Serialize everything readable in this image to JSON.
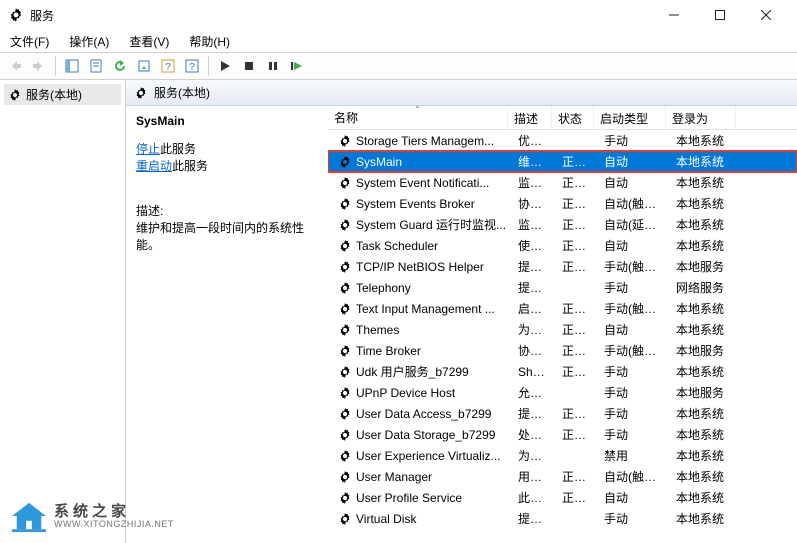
{
  "window": {
    "title": "服务"
  },
  "menu": {
    "file": "文件(F)",
    "action": "操作(A)",
    "view": "查看(V)",
    "help": "帮助(H)"
  },
  "tree": {
    "root": "服务(本地)"
  },
  "contentHeader": {
    "label": "服务(本地)"
  },
  "detail": {
    "selectedName": "SysMain",
    "stopLink": "停止",
    "stopSuffix": "此服务",
    "restartLink": "重启动",
    "restartSuffix": "此服务",
    "descLabel": "描述:",
    "descText": "维护和提高一段时间内的系统性能。"
  },
  "columns": {
    "name": "名称",
    "desc": "描述",
    "status": "状态",
    "startup": "启动类型",
    "logon": "登录为"
  },
  "services": [
    {
      "name": "Storage Tiers Managem...",
      "desc": "优化...",
      "status": "",
      "startup": "手动",
      "logon": "本地系统"
    },
    {
      "name": "SysMain",
      "desc": "维护...",
      "status": "正在...",
      "startup": "自动",
      "logon": "本地系统",
      "selected": true
    },
    {
      "name": "System Event Notificati...",
      "desc": "监视...",
      "status": "正在...",
      "startup": "自动",
      "logon": "本地系统"
    },
    {
      "name": "System Events Broker",
      "desc": "协调...",
      "status": "正在...",
      "startup": "自动(触发...",
      "logon": "本地系统"
    },
    {
      "name": "System Guard 运行时监视...",
      "desc": "监视...",
      "status": "正在...",
      "startup": "自动(延迟...",
      "logon": "本地系统"
    },
    {
      "name": "Task Scheduler",
      "desc": "使用...",
      "status": "正在...",
      "startup": "自动",
      "logon": "本地系统"
    },
    {
      "name": "TCP/IP NetBIOS Helper",
      "desc": "提供 ...",
      "status": "正在...",
      "startup": "手动(触发...",
      "logon": "本地服务"
    },
    {
      "name": "Telephony",
      "desc": "提供...",
      "status": "",
      "startup": "手动",
      "logon": "网络服务"
    },
    {
      "name": "Text Input Management ...",
      "desc": "启用...",
      "status": "正在...",
      "startup": "手动(触发...",
      "logon": "本地系统"
    },
    {
      "name": "Themes",
      "desc": "为用...",
      "status": "正在...",
      "startup": "自动",
      "logon": "本地系统"
    },
    {
      "name": "Time Broker",
      "desc": "协调...",
      "status": "正在...",
      "startup": "手动(触发...",
      "logon": "本地服务"
    },
    {
      "name": "Udk 用户服务_b7299",
      "desc": "Shell...",
      "status": "正在...",
      "startup": "手动",
      "logon": "本地系统"
    },
    {
      "name": "UPnP Device Host",
      "desc": "允许 ...",
      "status": "",
      "startup": "手动",
      "logon": "本地服务"
    },
    {
      "name": "User Data Access_b7299",
      "desc": "提供...",
      "status": "正在...",
      "startup": "手动",
      "logon": "本地系统"
    },
    {
      "name": "User Data Storage_b7299",
      "desc": "处理...",
      "status": "正在...",
      "startup": "手动",
      "logon": "本地系统"
    },
    {
      "name": "User Experience Virtualiz...",
      "desc": "为应...",
      "status": "",
      "startup": "禁用",
      "logon": "本地系统"
    },
    {
      "name": "User Manager",
      "desc": "用户...",
      "status": "正在...",
      "startup": "自动(触发...",
      "logon": "本地系统"
    },
    {
      "name": "User Profile Service",
      "desc": "此服...",
      "status": "正在...",
      "startup": "自动",
      "logon": "本地系统"
    },
    {
      "name": "Virtual Disk",
      "desc": "提供...",
      "status": "",
      "startup": "手动",
      "logon": "本地系统"
    }
  ],
  "watermark": {
    "cn": "系统之家",
    "url": "WWW.XITONGZHIJIA.NET"
  }
}
